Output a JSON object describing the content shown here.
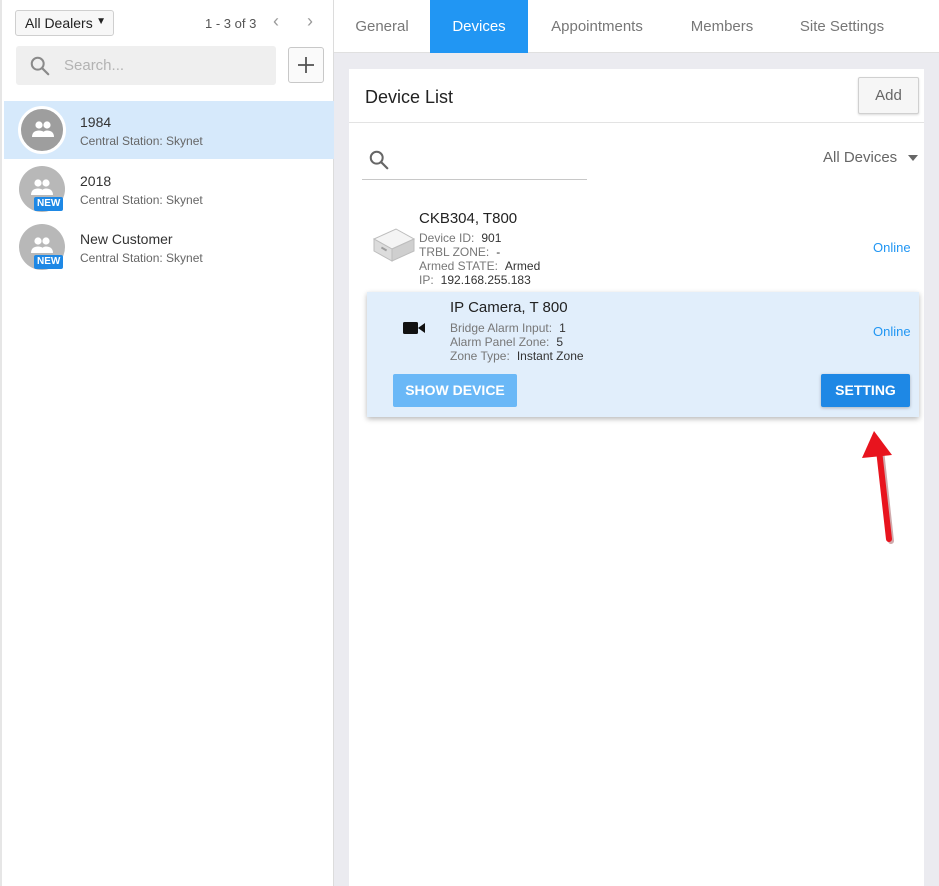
{
  "sidebar": {
    "dealer_filter": "All Dealers",
    "pagination": "1 - 3 of 3",
    "search_placeholder": "Search...",
    "customers": [
      {
        "name": "1984",
        "subtitle": "Central Station: Skynet",
        "selected": true,
        "badge": ""
      },
      {
        "name": "2018",
        "subtitle": "Central Station: Skynet",
        "selected": false,
        "badge": "NEW"
      },
      {
        "name": "New Customer",
        "subtitle": "Central Station: Skynet",
        "selected": false,
        "badge": "NEW"
      }
    ]
  },
  "tabs": [
    {
      "label": "General",
      "active": false
    },
    {
      "label": "Devices",
      "active": true
    },
    {
      "label": "Appointments",
      "active": false
    },
    {
      "label": "Members",
      "active": false
    },
    {
      "label": "Site Settings",
      "active": false
    }
  ],
  "device_list": {
    "title": "Device List",
    "add_label": "Add",
    "filter": "All Devices",
    "devices": [
      {
        "name": "CKB304, T800",
        "icon": "panel-box-icon",
        "fields": [
          {
            "label": "Device ID:",
            "value": "901"
          },
          {
            "label": "TRBL ZONE:",
            "value": "-"
          },
          {
            "label": "Armed STATE:",
            "value": "Armed"
          },
          {
            "label": "IP:",
            "value": "192.168.255.183"
          }
        ],
        "status": "Online"
      },
      {
        "name": "IP Camera, T 800",
        "icon": "video-camera-icon",
        "fields": [
          {
            "label": "Bridge Alarm Input:",
            "value": "1"
          },
          {
            "label": "Alarm Panel Zone:",
            "value": "5"
          },
          {
            "label": "Zone Type:",
            "value": "Instant Zone"
          }
        ],
        "status": "Online",
        "show_label": "SHOW DEVICE",
        "setting_label": "SETTING"
      }
    ]
  },
  "colors": {
    "accent": "#2196f3",
    "selected_row": "#d6e9fb",
    "annotation_arrow": "#e8141e"
  }
}
